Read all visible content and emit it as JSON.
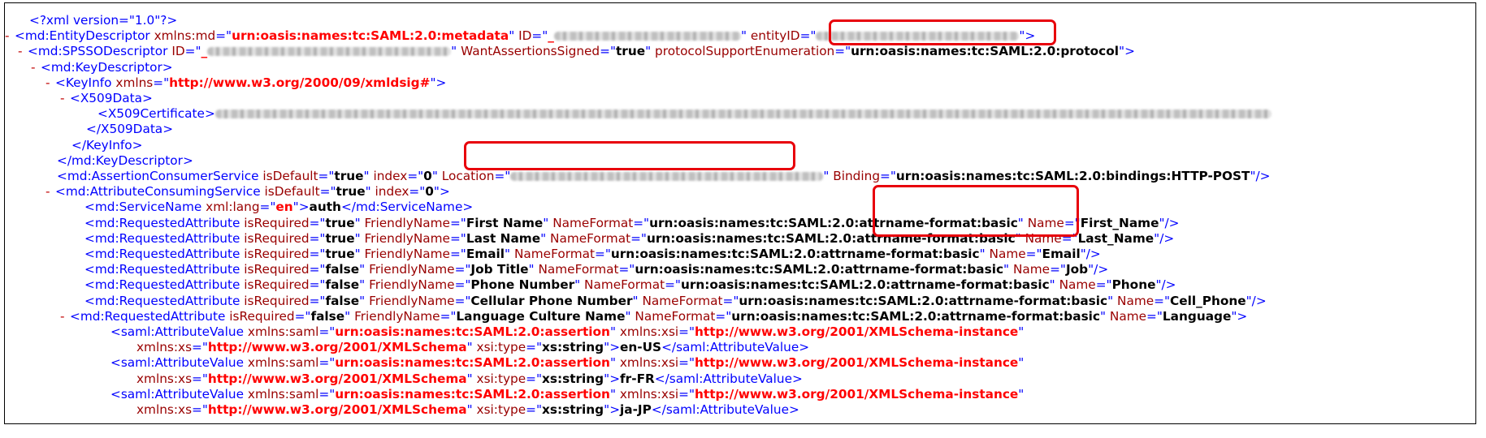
{
  "xml": {
    "declaration": "<?xml version=\"1.0\"?>",
    "entity_descriptor": {
      "tag": "md:EntityDescriptor",
      "xmlns_md_name": "xmlns:md",
      "xmlns_md": "urn:oasis:names:tc:SAML:2.0:metadata",
      "id_name": "ID",
      "id_prefix": "_",
      "entity_id_name": "entityID"
    },
    "spsso": {
      "tag": "md:SPSSODescriptor",
      "id_name": "ID",
      "id_prefix": "_",
      "want_name": "WantAssertionsSigned",
      "want_value": "true",
      "protocol_name": "protocolSupportEnumeration",
      "protocol_value": "urn:oasis:names:tc:SAML:2.0:protocol"
    },
    "key_descriptor_tag": "md:KeyDescriptor",
    "key_info": {
      "tag": "KeyInfo",
      "xmlns_name": "xmlns",
      "xmlns_value": "http://www.w3.org/2000/09/xmldsig#"
    },
    "x509data_tag": "X509Data",
    "x509cert_tag": "X509Certificate",
    "acs": {
      "tag": "md:AssertionConsumerService",
      "default_name": "isDefault",
      "default_value": "true",
      "index_name": "index",
      "index_value": "0",
      "location_name": "Location",
      "binding_name": "Binding",
      "binding_value": "urn:oasis:names:tc:SAML:2.0:bindings:HTTP-POST"
    },
    "attr_consuming": {
      "tag": "md:AttributeConsumingService",
      "default_name": "isDefault",
      "default_value": "true",
      "index_name": "index",
      "index_value": "0"
    },
    "service_name": {
      "tag": "md:ServiceName",
      "lang_name": "xml:lang",
      "lang_value": "en",
      "text": "auth"
    },
    "requested_attr_tag": "md:RequestedAttribute",
    "attr_names": {
      "is_required": "isRequired",
      "friendly": "FriendlyName",
      "name_format": "NameFormat",
      "name": "Name"
    },
    "name_format_value": "urn:oasis:names:tc:SAML:2.0:attrname-format:basic",
    "requested_attributes": [
      {
        "required": "true",
        "friendly": "First Name",
        "name": "First_Name"
      },
      {
        "required": "true",
        "friendly": "Last Name",
        "name": "Last_Name"
      },
      {
        "required": "true",
        "friendly": "Email",
        "name": "Email"
      },
      {
        "required": "false",
        "friendly": "Job Title",
        "name": "Job"
      },
      {
        "required": "false",
        "friendly": "Phone Number",
        "name": "Phone"
      },
      {
        "required": "false",
        "friendly": "Cellular Phone Number",
        "name": "Cell_Phone"
      },
      {
        "required": "false",
        "friendly": "Language Culture Name",
        "name": "Language"
      }
    ],
    "attribute_value": {
      "tag": "saml:AttributeValue",
      "xmlns_saml_name": "xmlns:saml",
      "xmlns_saml": "urn:oasis:names:tc:SAML:2.0:assertion",
      "xmlns_xsi_name": "xmlns:xsi",
      "xmlns_xsi": "http://www.w3.org/2001/XMLSchema-instance",
      "xmlns_xs_name": "xmlns:xs",
      "xmlns_xs": "http://www.w3.org/2001/XMLSchema",
      "type_name": "xsi:type",
      "type_value": "xs:string",
      "values": [
        "en-US",
        "fr-FR",
        "ja-JP"
      ]
    },
    "collapse_glyph": "-"
  },
  "colors": {
    "tag": "#0000ff",
    "attr_name": "#990000",
    "attr_value": "#ff0000",
    "highlight": "#e8000b"
  }
}
